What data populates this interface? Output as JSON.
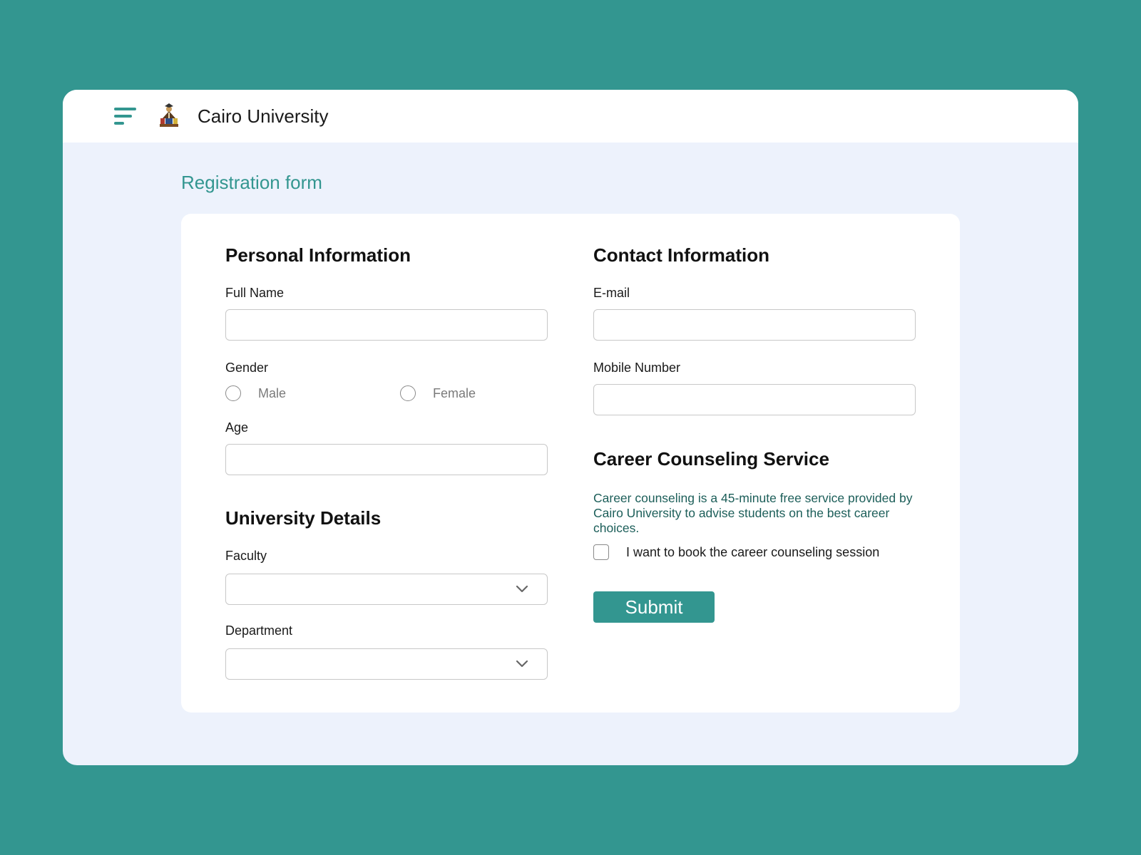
{
  "header": {
    "menu_icon": "hamburger-menu-icon",
    "logo_icon": "university-logo",
    "title": "Cairo University"
  },
  "page": {
    "title": "Registration form"
  },
  "personal": {
    "heading": "Personal Information",
    "full_name": {
      "label": "Full Name",
      "value": "",
      "placeholder": ""
    },
    "gender": {
      "label": "Gender",
      "options": [
        "Male",
        "Female"
      ],
      "selected": null
    },
    "age": {
      "label": "Age",
      "value": "",
      "placeholder": ""
    }
  },
  "university": {
    "heading": "University Details",
    "faculty": {
      "label": "Faculty",
      "value": ""
    },
    "department": {
      "label": "Department",
      "value": ""
    }
  },
  "contact": {
    "heading": "Contact Information",
    "email": {
      "label": "E-mail",
      "value": "",
      "placeholder": ""
    },
    "mobile": {
      "label": "Mobile Number",
      "value": "",
      "placeholder": ""
    }
  },
  "career": {
    "heading": "Career Counseling Service",
    "description": "Career counseling is a 45-minute free service provided by Cairo University to advise students on the best career choices.",
    "checkbox_label": "I want to book the career counseling session",
    "checked": false
  },
  "submit_label": "Submit",
  "colors": {
    "background": "#339690",
    "accent": "#339690",
    "panel": "#edf2fc",
    "card": "#ffffff",
    "description_text": "#1c5e59"
  }
}
